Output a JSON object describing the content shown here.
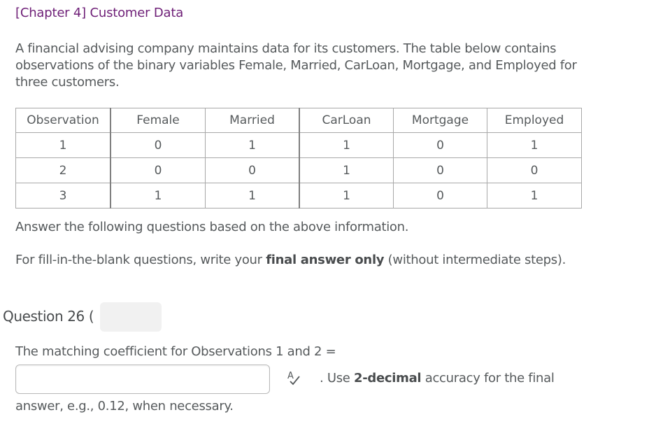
{
  "header": {
    "title": "[Chapter 4] Customer Data"
  },
  "intro": {
    "text": "A financial advising company maintains data for its customers. The table below contains observations of the binary variables Female, Married, CarLoan, Mortgage, and Employed for three customers."
  },
  "table": {
    "columns": [
      "Observation",
      "Female",
      "Married",
      "CarLoan",
      "Mortgage",
      "Employed"
    ],
    "rows": [
      [
        "1",
        "0",
        "1",
        "1",
        "0",
        "1"
      ],
      [
        "2",
        "0",
        "0",
        "1",
        "0",
        "0"
      ],
      [
        "3",
        "1",
        "1",
        "1",
        "0",
        "1"
      ]
    ]
  },
  "instructions": {
    "answer_line": "Answer the following questions based on the above information.",
    "fill_prefix": "For fill-in-the-blank questions, write your ",
    "fill_bold": "final answer only",
    "fill_suffix": " (without intermediate steps)."
  },
  "question": {
    "heading": "Question 26 (",
    "prompt": "The matching coefficient for Observations 1 and 2 =",
    "answer_value": "",
    "answer_placeholder": "",
    "spellcheck_icon": "spellcheck-icon",
    "hint_prefix": ". Use ",
    "hint_bold": "2-decimal",
    "hint_suffix": " accuracy for the final",
    "hint_continued": "answer, e.g., 0.12, when necessary."
  }
}
